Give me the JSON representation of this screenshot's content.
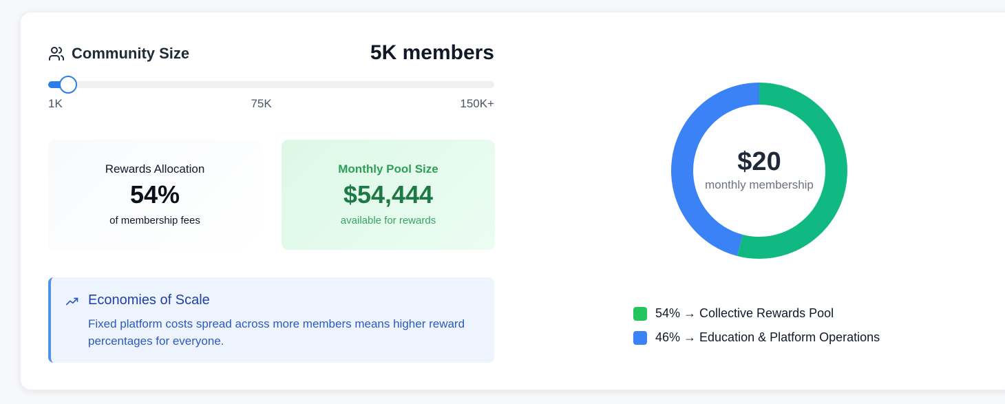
{
  "header": {
    "title": "Community Size",
    "title_icon": "users-icon",
    "members_value": "5K members"
  },
  "slider": {
    "min_label": "1K",
    "mid_label": "75K",
    "max_label": "150K+",
    "value_fraction": 0.045,
    "accent_color": "#2b7de9"
  },
  "rewards_allocation": {
    "title": "Rewards Allocation",
    "value": "54%",
    "subtitle": "of membership fees"
  },
  "monthly_pool": {
    "title": "Monthly Pool Size",
    "value": "$54,444",
    "subtitle": "available for rewards"
  },
  "callout": {
    "icon": "trending-up-icon",
    "title": "Economies of Scale",
    "body": "Fixed platform costs spread across more members means higher reward percentages for everyone."
  },
  "donut": {
    "amount": "$20",
    "caption": "monthly membership",
    "segments": [
      {
        "percent": 54,
        "color": "#10b981"
      },
      {
        "percent": 46,
        "color": "#3b82f6"
      }
    ]
  },
  "legend": [
    {
      "label": "54% → Collective Rewards Pool",
      "color": "#22c55e"
    },
    {
      "label": "46% → Education & Platform Operations",
      "color": "#3b82f6"
    }
  ]
}
